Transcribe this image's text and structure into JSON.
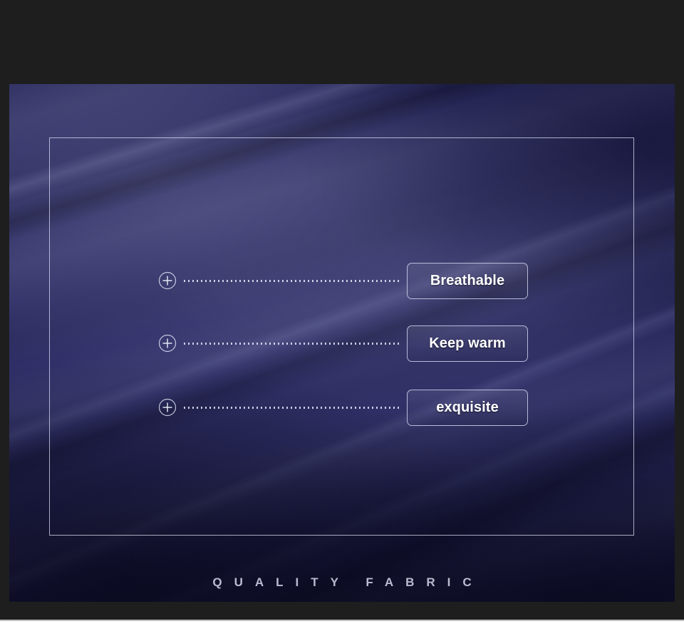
{
  "banner": {
    "background_color": "#1e1e1e",
    "photo": {
      "alt_subject": "navy blue satin fabric with diagonal folds",
      "base_color": "#2e2e66",
      "highlight_color": "#3a3a78",
      "shadow_color": "#1a1a3c"
    },
    "inset_frame": {
      "name": "thin white rectangular border",
      "color": "#e2e6f8"
    }
  },
  "features": [
    {
      "icon": "plus-circle-icon",
      "leader": "dotted-leader-line",
      "label": "Breathable"
    },
    {
      "icon": "plus-circle-icon",
      "leader": "dotted-leader-line",
      "label": "Keep warm"
    },
    {
      "icon": "plus-circle-icon",
      "leader": "dotted-leader-line",
      "label": "exquisite"
    }
  ],
  "caption": {
    "text": "QUALITY FABRIC",
    "color": "#c8ccdf"
  }
}
